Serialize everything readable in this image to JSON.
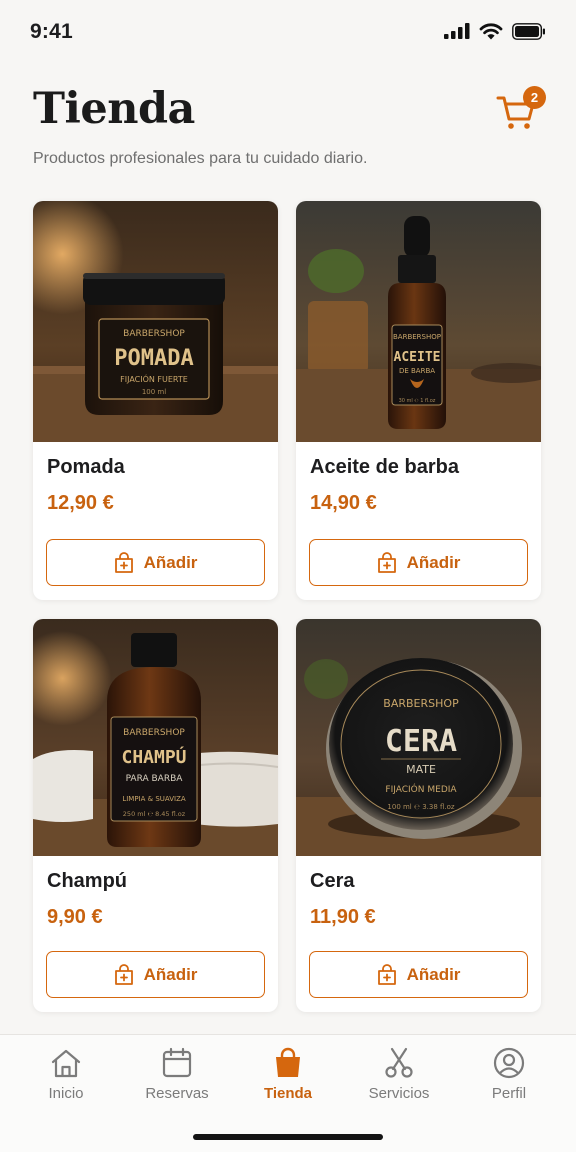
{
  "status_bar": {
    "time": "9:41"
  },
  "header": {
    "title": "Tienda",
    "subtitle": "Productos profesionales para tu cuidado diario.",
    "cart_count": "2"
  },
  "products": [
    {
      "name": "Pomada",
      "price": "12,90 €",
      "add_label": "Añadir",
      "label_brand": "BARBERSHOP",
      "label_title": "POMADA",
      "label_sub": "FIJACIÓN FUERTE",
      "label_volume": "100 ml"
    },
    {
      "name": "Aceite de barba",
      "price": "14,90 €",
      "add_label": "Añadir",
      "label_brand": "BARBERSHOP",
      "label_title": "ACEITE",
      "label_sub": "DE BARBA",
      "label_volume": "30 ml ℮ 1 fl.oz"
    },
    {
      "name": "Champú",
      "price": "9,90 €",
      "add_label": "Añadir",
      "label_brand": "BARBERSHOP",
      "label_title": "CHAMPÚ",
      "label_sub": "PARA BARBA",
      "label_extra": "LIMPIA & SUAVIZA",
      "label_volume": "250 ml ℮ 8.45 fl.oz"
    },
    {
      "name": "Cera",
      "price": "11,90 €",
      "add_label": "Añadir",
      "label_brand": "BARBERSHOP",
      "label_title": "CERA",
      "label_sub": "MATE",
      "label_extra": "FIJACIÓN MEDIA",
      "label_volume": "100 ml ℮ 3.38 fl.oz"
    }
  ],
  "tabbar": {
    "items": [
      {
        "label": "Inicio",
        "icon": "home-icon"
      },
      {
        "label": "Reservas",
        "icon": "calendar-icon"
      },
      {
        "label": "Tienda",
        "icon": "shopping-bag-icon",
        "active": true
      },
      {
        "label": "Servicios",
        "icon": "scissors-icon"
      },
      {
        "label": "Perfil",
        "icon": "user-icon"
      }
    ]
  },
  "colors": {
    "accent": "#d5670e",
    "price": "#c8620f",
    "background": "#f7f6f4"
  }
}
